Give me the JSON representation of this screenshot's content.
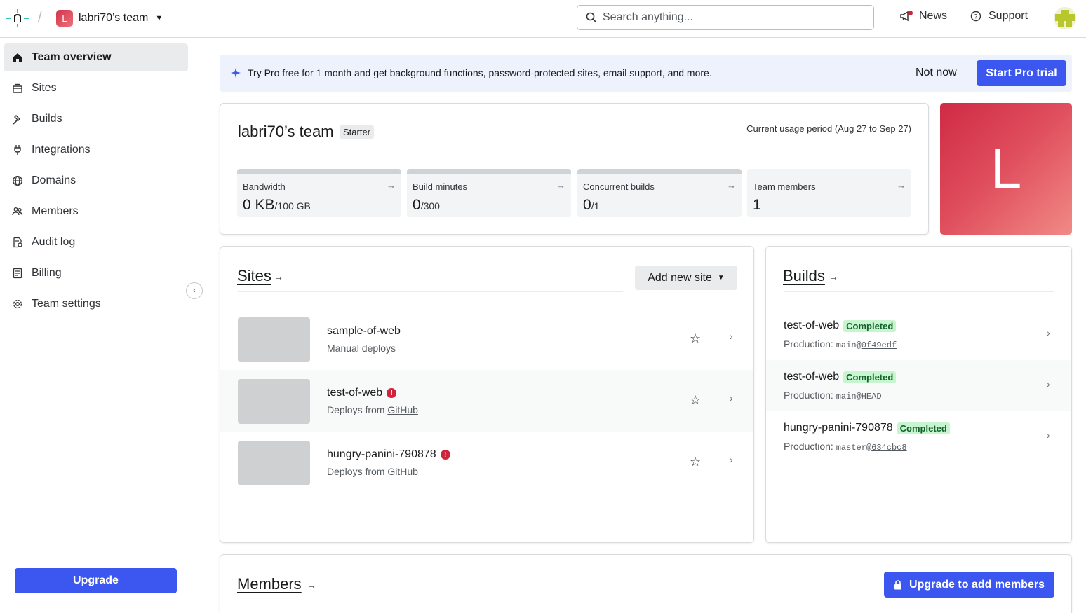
{
  "header": {
    "team_initial": "L",
    "team_name": "labri70’s team",
    "search_placeholder": "Search anything...",
    "news_label": "News",
    "support_label": "Support"
  },
  "sidebar": {
    "items": [
      {
        "label": "Team overview",
        "icon": "home-icon",
        "active": true
      },
      {
        "label": "Sites",
        "icon": "sites-icon"
      },
      {
        "label": "Builds",
        "icon": "hammer-icon"
      },
      {
        "label": "Integrations",
        "icon": "plug-icon"
      },
      {
        "label": "Domains",
        "icon": "globe-icon"
      },
      {
        "label": "Members",
        "icon": "users-icon"
      },
      {
        "label": "Audit log",
        "icon": "audit-icon"
      },
      {
        "label": "Billing",
        "icon": "receipt-icon"
      },
      {
        "label": "Team settings",
        "icon": "gear-icon"
      }
    ],
    "upgrade_label": "Upgrade"
  },
  "banner": {
    "message": "Try Pro free for 1 month and get background functions, password-protected sites, email support, and more.",
    "dismiss_label": "Not now",
    "cta_label": "Start Pro trial"
  },
  "team_card": {
    "title": "labri70’s team",
    "plan_badge": "Starter",
    "usage_period": "Current usage period (Aug 27 to Sep 27)",
    "avatar_initial": "L",
    "stats": [
      {
        "label": "Bandwidth",
        "value": "0 KB",
        "limit": "/100 GB"
      },
      {
        "label": "Build minutes",
        "value": "0",
        "limit": "/300"
      },
      {
        "label": "Concurrent builds",
        "value": "0",
        "limit": "/1"
      },
      {
        "label": "Team members",
        "value": "1",
        "limit": ""
      }
    ]
  },
  "sites": {
    "title": "Sites",
    "arrow": "→",
    "add_label": "Add new site",
    "items": [
      {
        "name": "sample-of-web",
        "desc": "Manual deploys",
        "error": false,
        "provider": ""
      },
      {
        "name": "test-of-web",
        "desc": "Deploys from ",
        "error": true,
        "provider": "GitHub"
      },
      {
        "name": "hungry-panini-790878",
        "desc": "Deploys from ",
        "error": true,
        "provider": "GitHub"
      }
    ]
  },
  "builds": {
    "title": "Builds",
    "arrow": "→",
    "items": [
      {
        "name": "test-of-web",
        "status": "Completed",
        "context": "Production: ",
        "branch": "main@",
        "ref": "0f49edf",
        "ref_link": true
      },
      {
        "name": "test-of-web",
        "status": "Completed",
        "context": "Production: ",
        "branch": "main@",
        "ref": "HEAD",
        "ref_link": false
      },
      {
        "name": "hungry-panini-790878",
        "status": "Completed",
        "context": "Production: ",
        "branch": "master@",
        "ref": "634cbc8",
        "ref_link": true
      }
    ]
  },
  "members": {
    "title": "Members",
    "arrow": "→",
    "upgrade_label": "Upgrade to add members"
  },
  "colors": {
    "accent": "#3b57f0",
    "team_gradient_start": "#cf2a44",
    "team_gradient_end": "#f18a86",
    "completed_bg": "#c7f5cf",
    "error": "#d0243c"
  }
}
